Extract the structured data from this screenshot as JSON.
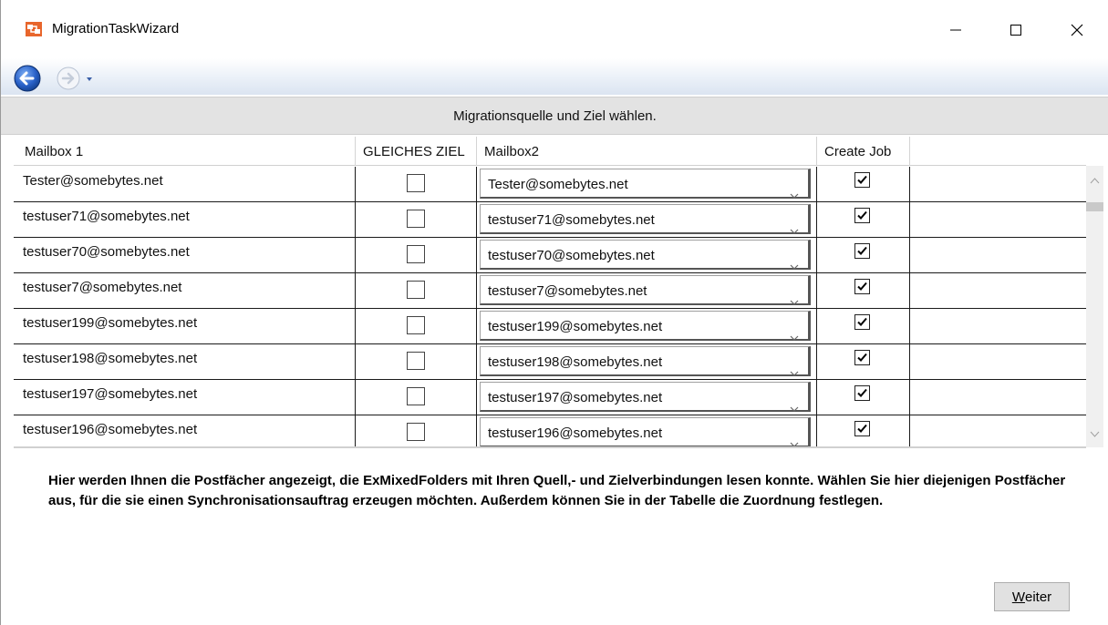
{
  "window": {
    "title": "MigrationTaskWizard"
  },
  "header": {
    "title": "Migrationsquelle und Ziel wählen."
  },
  "grid": {
    "columns": [
      "Mailbox 1",
      "GLEICHES ZIEL",
      "Mailbox2",
      "Create Job",
      ""
    ],
    "rows": [
      {
        "mailbox1": "Tester@somebytes.net",
        "same_target": false,
        "mailbox2": "Tester@somebytes.net",
        "create_job": true
      },
      {
        "mailbox1": "testuser71@somebytes.net",
        "same_target": false,
        "mailbox2": "testuser71@somebytes.net",
        "create_job": true
      },
      {
        "mailbox1": "testuser70@somebytes.net",
        "same_target": false,
        "mailbox2": "testuser70@somebytes.net",
        "create_job": true
      },
      {
        "mailbox1": "testuser7@somebytes.net",
        "same_target": false,
        "mailbox2": "testuser7@somebytes.net",
        "create_job": true
      },
      {
        "mailbox1": "testuser199@somebytes.net",
        "same_target": false,
        "mailbox2": "testuser199@somebytes.net",
        "create_job": true
      },
      {
        "mailbox1": "testuser198@somebytes.net",
        "same_target": false,
        "mailbox2": "testuser198@somebytes.net",
        "create_job": true
      },
      {
        "mailbox1": "testuser197@somebytes.net",
        "same_target": false,
        "mailbox2": "testuser197@somebytes.net",
        "create_job": true
      },
      {
        "mailbox1": "testuser196@somebytes.net",
        "same_target": false,
        "mailbox2": "testuser196@somebytes.net",
        "create_job": true
      }
    ]
  },
  "info": {
    "text": "Hier werden Ihnen die Postfächer angezeigt, die ExMixedFolders mit Ihren Quell,- und Zielverbindungen lesen konnte. Wählen Sie hier diejenigen Postfächer aus, für die sie einen Synchronisationsauftrag erzeugen möchten. Außerdem können Sie in der Tabelle die Zuordnung festlegen."
  },
  "buttons": {
    "next_underlined": "W",
    "next_rest": "eiter"
  },
  "icons": {
    "app": "migration-app-icon",
    "back": "back-arrow-icon",
    "forward": "forward-arrow-icon",
    "minimize": "minimize-icon",
    "maximize": "maximize-icon",
    "close": "close-icon"
  },
  "colors": {
    "header_bg": "#e3e3e3",
    "nav_accent": "#2a62c9",
    "button_bg": "#e1e1e1"
  }
}
